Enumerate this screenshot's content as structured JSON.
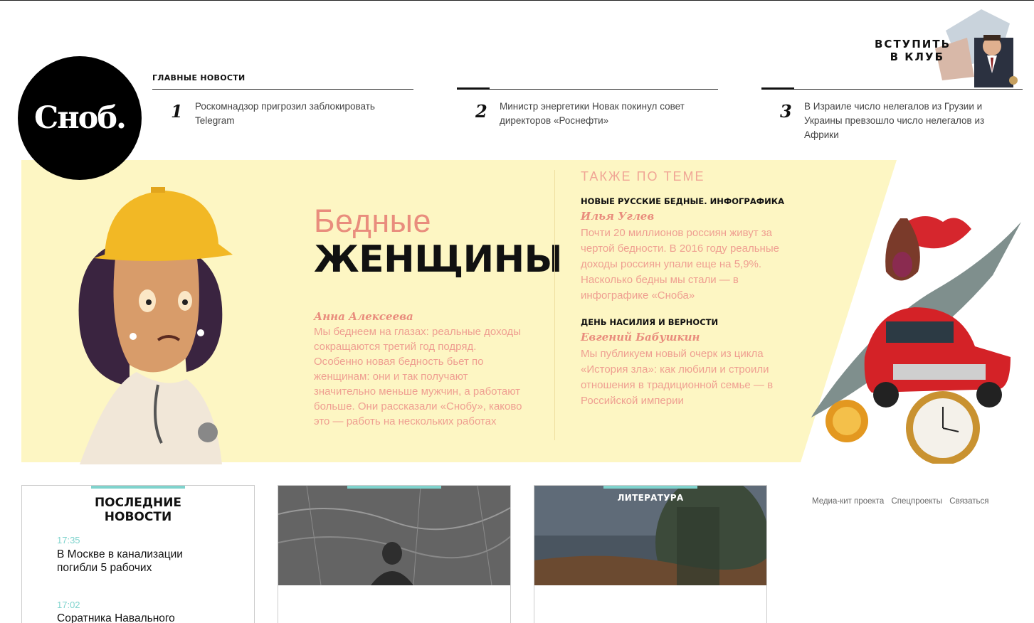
{
  "brand": {
    "logo_text": "Сноб."
  },
  "header": {
    "news_heading": "ГЛАВНЫЕ НОВОСТИ",
    "top_news": [
      {
        "num": "1",
        "title": "Роскомнадзор пригрозил заблокировать Telegram"
      },
      {
        "num": "2",
        "title": "Министр энергетики Новак покинул совет директоров «Роснефти»"
      },
      {
        "num": "3",
        "title": "В Израиле число нелегалов из Грузии и Украины превзошло число нелегалов из Африки"
      }
    ],
    "club_line1": "ВСТУПИТЬ",
    "club_line2": "В КЛУБ"
  },
  "feature": {
    "kicker_light": "Бедные",
    "kicker_bold": "ЖЕНЩИНЫ",
    "author": "Анна Алексеева",
    "lead": "Мы беднеем на глазах: реальные доходы сокращаются третий год подряд. Особенно новая бедность бьет по женщинам: они и так получают значительно меньше мужчин, а работают больше. Они рассказали «Снобу», каково это — работь на нескольких работах",
    "related_heading": "ТАКЖЕ ПО ТЕМЕ",
    "related": [
      {
        "title": "НОВЫЕ РУССКИЕ БЕДНЫЕ. ИНФОГРАФИКА",
        "author": "Илья Углев",
        "text": "Почти 20 миллионов россиян живут за чертой бедности. В 2016 году реальные доходы россиян упали еще на 5,9%. Насколько бедны мы стали — в инфографике «Сноба»"
      },
      {
        "title": "ДЕНЬ НАСИЛИЯ И ВЕРНОСТИ",
        "author": "Евгений Бабушкин",
        "text": "Мы публикуем новый очерк из цикла «История зла»: как любили и строили отношения в традиционной семье — в Российской империи"
      }
    ]
  },
  "latest": {
    "title_line1": "ПОСЛЕДНИЕ",
    "title_line2": "НОВОСТИ",
    "items": [
      {
        "time": "17:35",
        "title": "В Москве в канализации погибли 5 рабочих"
      },
      {
        "time": "17:02",
        "title": "Соратника Навального"
      }
    ]
  },
  "cards": {
    "literature_label": "ЛИТЕРАТУРА"
  },
  "footer_links": [
    "Медиа-кит проекта",
    "Спецпроекты",
    "Связаться"
  ],
  "colors": {
    "accent_pink": "#e98d7d",
    "feature_bg": "#fdf6c3",
    "teal": "#7fd3cd"
  }
}
